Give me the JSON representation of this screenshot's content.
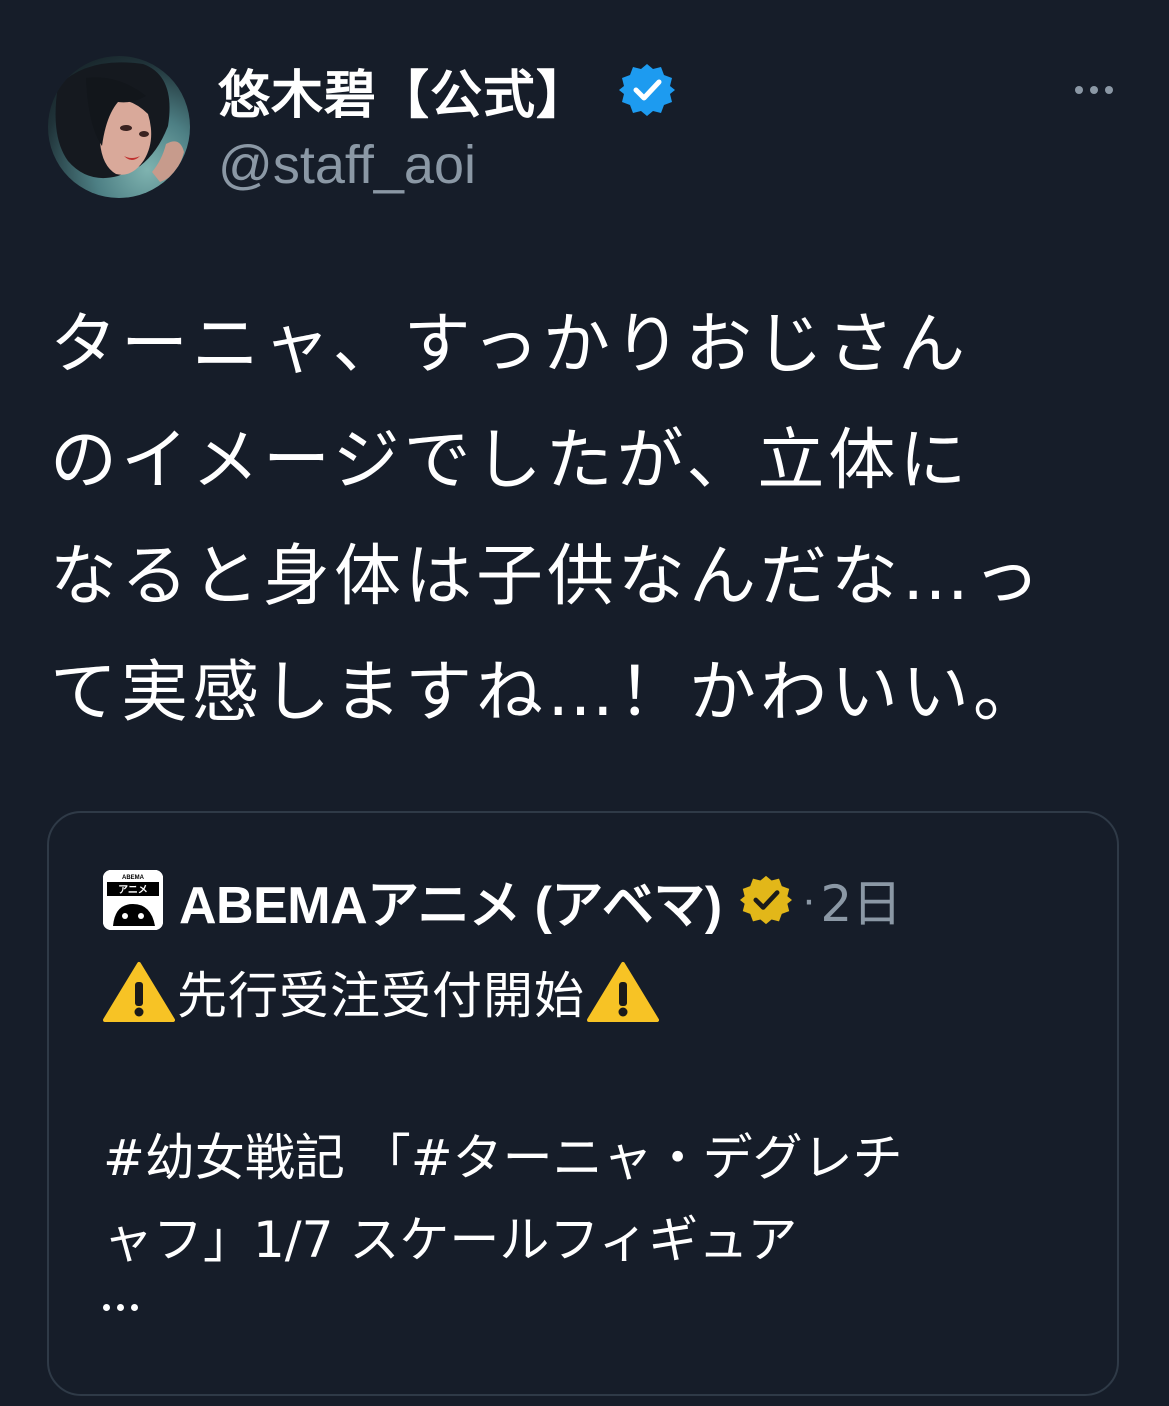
{
  "author": {
    "display_name": "悠木碧【公式】",
    "handle": "@staff_aoi",
    "verified_badge": "blue-check-icon",
    "avatar": "profile-photo"
  },
  "more_menu_icon": "more-horizontal-icon",
  "tweet": {
    "lines": [
      "ターニャ、すっかりおじさん",
      "のイメージでしたが、立体に",
      "なると身体は子供なんだな…っ",
      "て実感しますね…！かわいい。"
    ]
  },
  "quoted_tweet": {
    "author_name": "ABEMAアニメ (アベマ)",
    "avatar_label_top": "ABEMA",
    "avatar_label": "アニメ",
    "verified_badge": "gold-check-icon",
    "separator": "·",
    "time": "2日",
    "headline": "先行受注受付開始",
    "headline_icon": "warning-icon",
    "body_lines": [
      "#幼女戦記 「#ターニャ・デグレチ",
      "ャフ」1/7 スケールフィギュア"
    ],
    "truncation": "..."
  },
  "colors": {
    "background": "#161d29",
    "text_primary": "#ffffff",
    "text_secondary": "#8b98a5",
    "border": "#2f3a47",
    "verified_blue": "#1d9bf0",
    "verified_gold": "#e2b719",
    "warning_yellow": "#f7c325"
  }
}
